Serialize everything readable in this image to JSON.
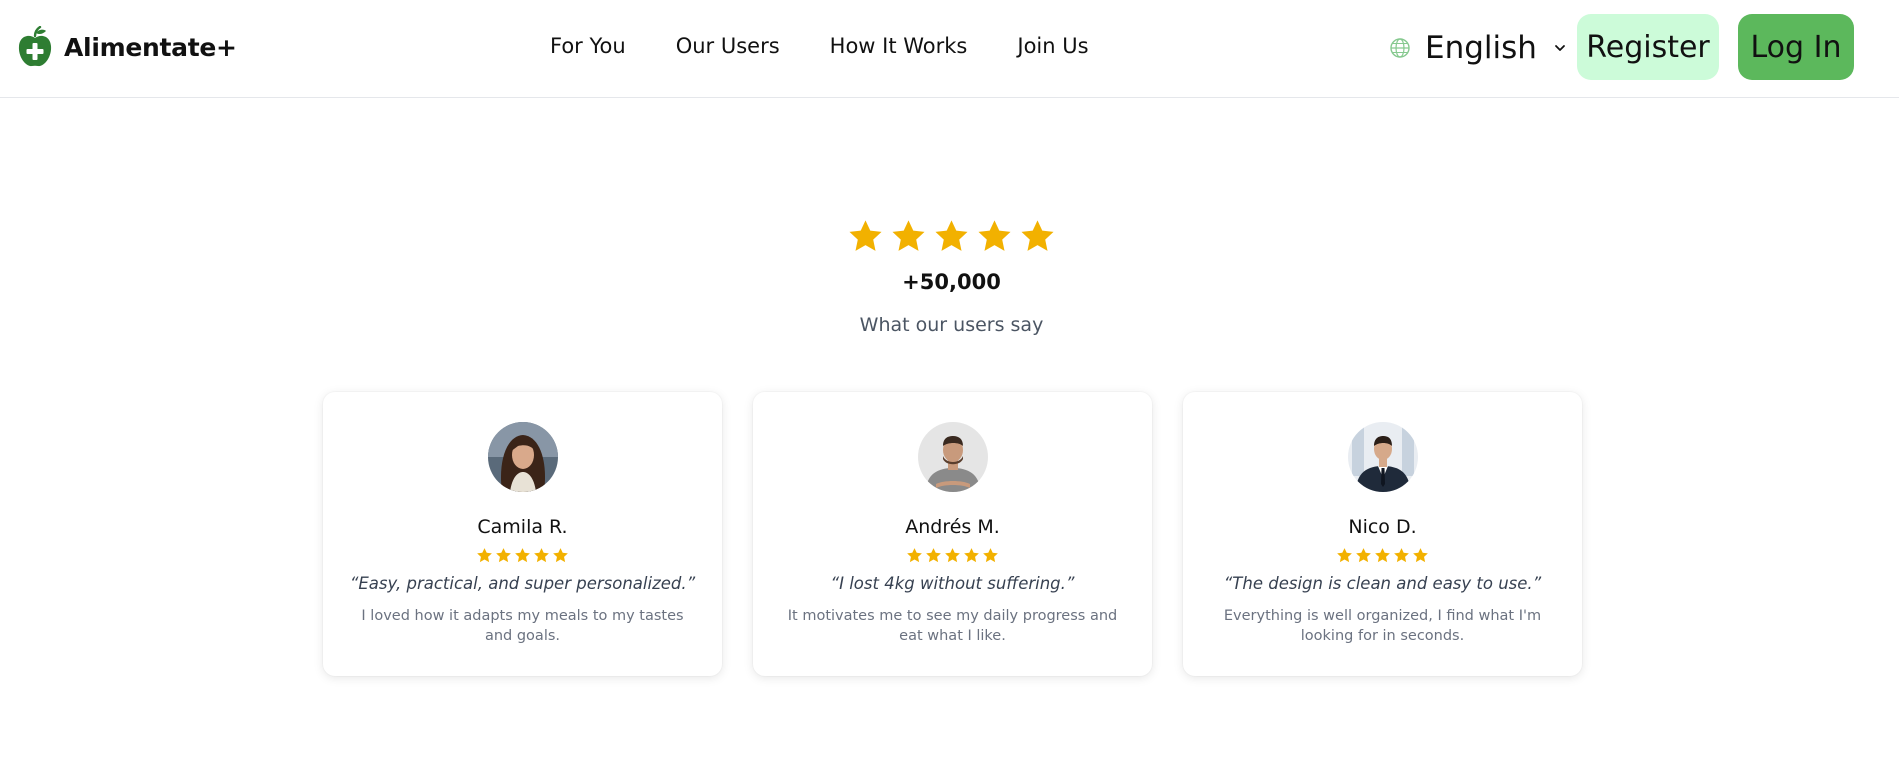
{
  "brand": {
    "name": "Alimentate+",
    "logo_icon": "apple-plus-icon",
    "accent": "#2e7d32"
  },
  "nav": {
    "items": [
      {
        "label": "For You"
      },
      {
        "label": "Our Users"
      },
      {
        "label": "How It Works"
      },
      {
        "label": "Join Us"
      }
    ]
  },
  "language": {
    "icon": "globe-icon",
    "selected": "English"
  },
  "auth": {
    "register_label": "Register",
    "login_label": "Log In",
    "register_color": "#ccfbd9",
    "login_color": "#5cb85c"
  },
  "hero": {
    "rating_stars": 5,
    "count": "+50,000",
    "subtitle": "What our users say",
    "star_color": "#f2b100"
  },
  "testimonials": [
    {
      "name": "Camila R.",
      "rating": 5,
      "quote": "“Easy, practical, and super personalized.”",
      "text": "I loved how it adapts my meals to my tastes and goals."
    },
    {
      "name": "Andrés M.",
      "rating": 5,
      "quote": "“I lost 4kg without suffering.”",
      "text": "It motivates me to see my daily progress and eat what I like."
    },
    {
      "name": "Nico D.",
      "rating": 5,
      "quote": "“The design is clean and easy to use.”",
      "text": "Everything is well organized, I find what I'm looking for in seconds."
    }
  ]
}
